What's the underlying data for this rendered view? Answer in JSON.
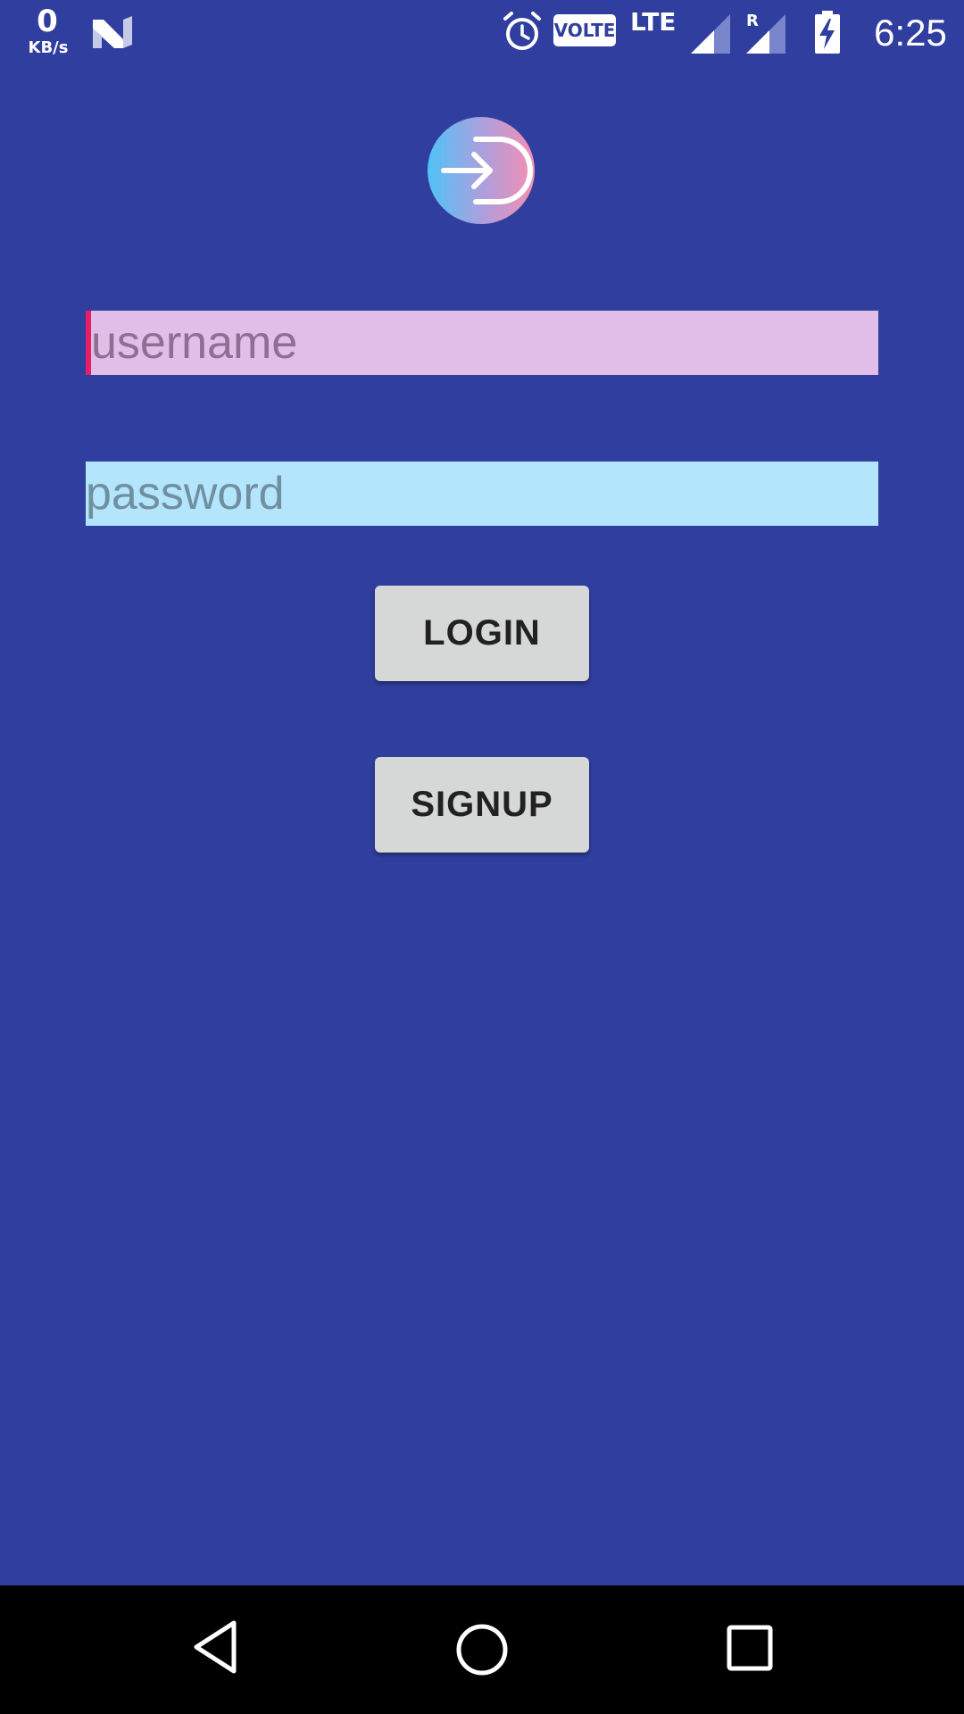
{
  "status_bar": {
    "net_speed_value": "0",
    "net_speed_unit": "KB/s",
    "volte_label": "VOLTE",
    "network_type": "LTE",
    "roaming_label": "R",
    "time": "6:25",
    "icons": [
      "n-notification-icon",
      "alarm-icon",
      "volte-badge",
      "cell-signal-icon",
      "roaming-signal-icon",
      "battery-charging-icon"
    ]
  },
  "login": {
    "logo_icon": "login-arrow-icon",
    "username_placeholder": "username",
    "password_placeholder": "password",
    "login_label": "LOGIN",
    "signup_label": "SIGNUP"
  },
  "nav_bar": {
    "icons": [
      "back-icon",
      "home-icon",
      "recents-icon"
    ]
  },
  "colors": {
    "background": "#303F9F",
    "username_bg": "#E1BEE7",
    "password_bg": "#B3E5FC",
    "cursor_accent": "#E91E63",
    "button_bg": "#D6D7D7",
    "nav_bar_bg": "#000000"
  }
}
